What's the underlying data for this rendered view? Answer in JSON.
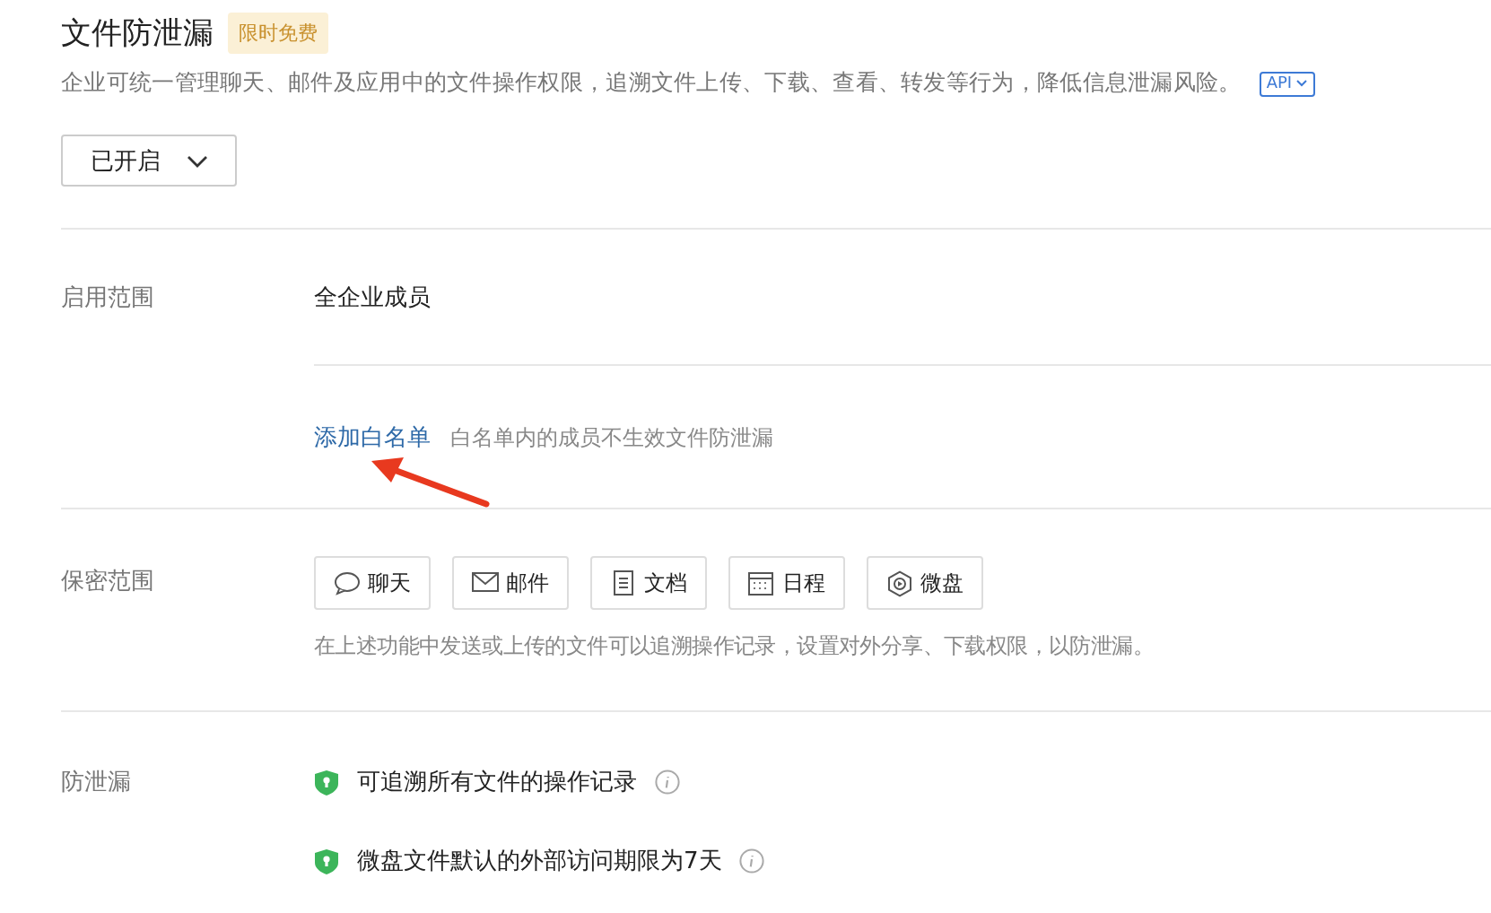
{
  "header": {
    "title": "文件防泄漏",
    "badge": "限时免费",
    "description": "企业可统一管理聊天、邮件及应用中的文件操作权限，追溯文件上传、下载、查看、转发等行为，降低信息泄漏风险。",
    "api_link": "API"
  },
  "status_dropdown": {
    "value": "已开启"
  },
  "scope": {
    "label": "启用范围",
    "value": "全企业成员",
    "whitelist_link": "添加白名单",
    "whitelist_hint": "白名单内的成员不生效文件防泄漏"
  },
  "confidential": {
    "label": "保密范围",
    "chips": [
      {
        "kind": "chat",
        "label": "聊天"
      },
      {
        "kind": "mail",
        "label": "邮件"
      },
      {
        "kind": "doc",
        "label": "文档"
      },
      {
        "kind": "calendar",
        "label": "日程"
      },
      {
        "kind": "drive",
        "label": "微盘"
      }
    ],
    "hint": "在上述功能中发送或上传的文件可以追溯操作记录，设置对外分享、下载权限，以防泄漏。"
  },
  "protection": {
    "label": "防泄漏",
    "items": [
      {
        "text": "可追溯所有文件的操作记录"
      },
      {
        "text": "微盘文件默认的外部访问期限为7天"
      }
    ]
  }
}
